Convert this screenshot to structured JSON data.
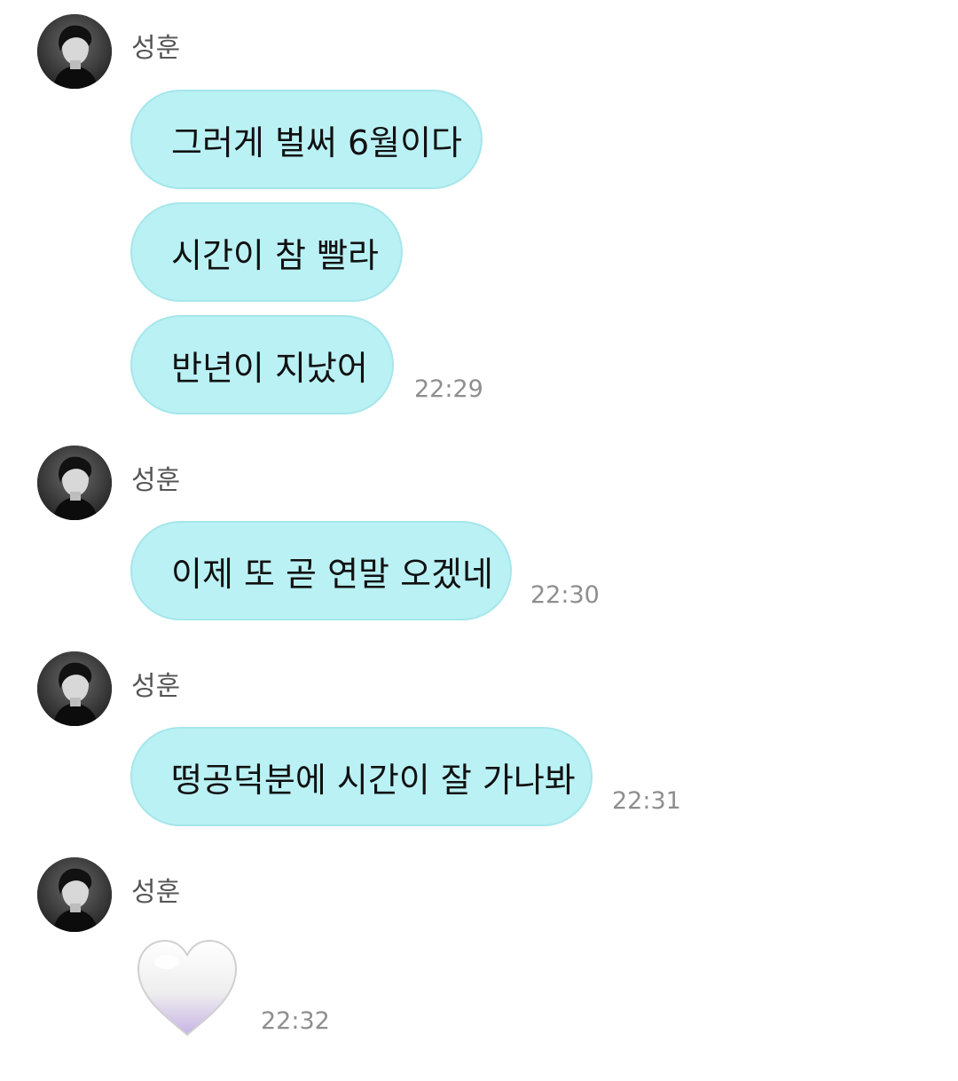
{
  "chat": {
    "groups": [
      {
        "sender": "성훈",
        "messages": [
          "그러게 벌써 6월이다",
          "시간이 참 빨라",
          "반년이 지났어"
        ],
        "time": "22:29"
      },
      {
        "sender": "성훈",
        "messages": [
          "이제 또 곧 연말 오겠네"
        ],
        "time": "22:30"
      },
      {
        "sender": "성훈",
        "messages": [
          "떵공덕분에 시간이 잘 가나봐"
        ],
        "time": "22:31"
      },
      {
        "sender": "성훈",
        "emoji": "white-heart-icon",
        "time": "22:32"
      }
    ]
  },
  "colors": {
    "bubble": "#baf1f4",
    "bubble_border": "#a6e6ea",
    "timestamp": "#8e8e8e",
    "sender": "#555555"
  }
}
